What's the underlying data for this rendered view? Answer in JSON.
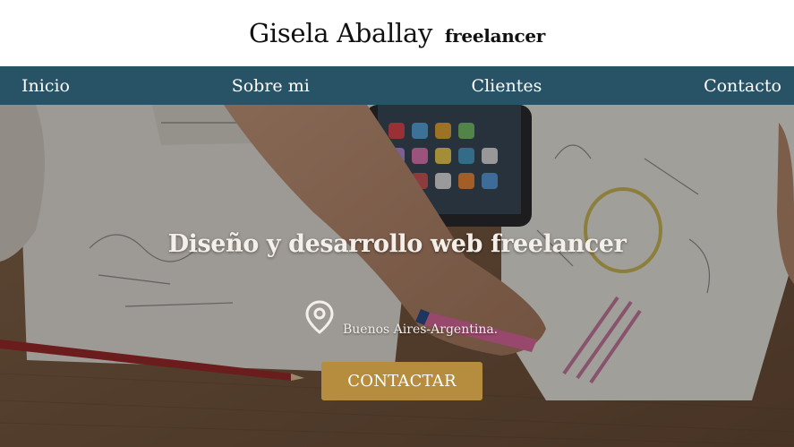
{
  "header": {
    "name": "Gisela Aballay",
    "role": "freelancer"
  },
  "nav": {
    "items": [
      "Inicio",
      "Sobre mi",
      "Clientes",
      "Contacto"
    ]
  },
  "hero": {
    "title": "Diseño y desarrollo web freelancer",
    "location": "Buenos Aires-Argentina.",
    "location_icon": "map-pin-icon",
    "cta_label": "CONTACTAR"
  },
  "colors": {
    "nav_bg": "#285366",
    "cta_bg": "#b68d3e",
    "hero_text": "#f4efe8"
  }
}
